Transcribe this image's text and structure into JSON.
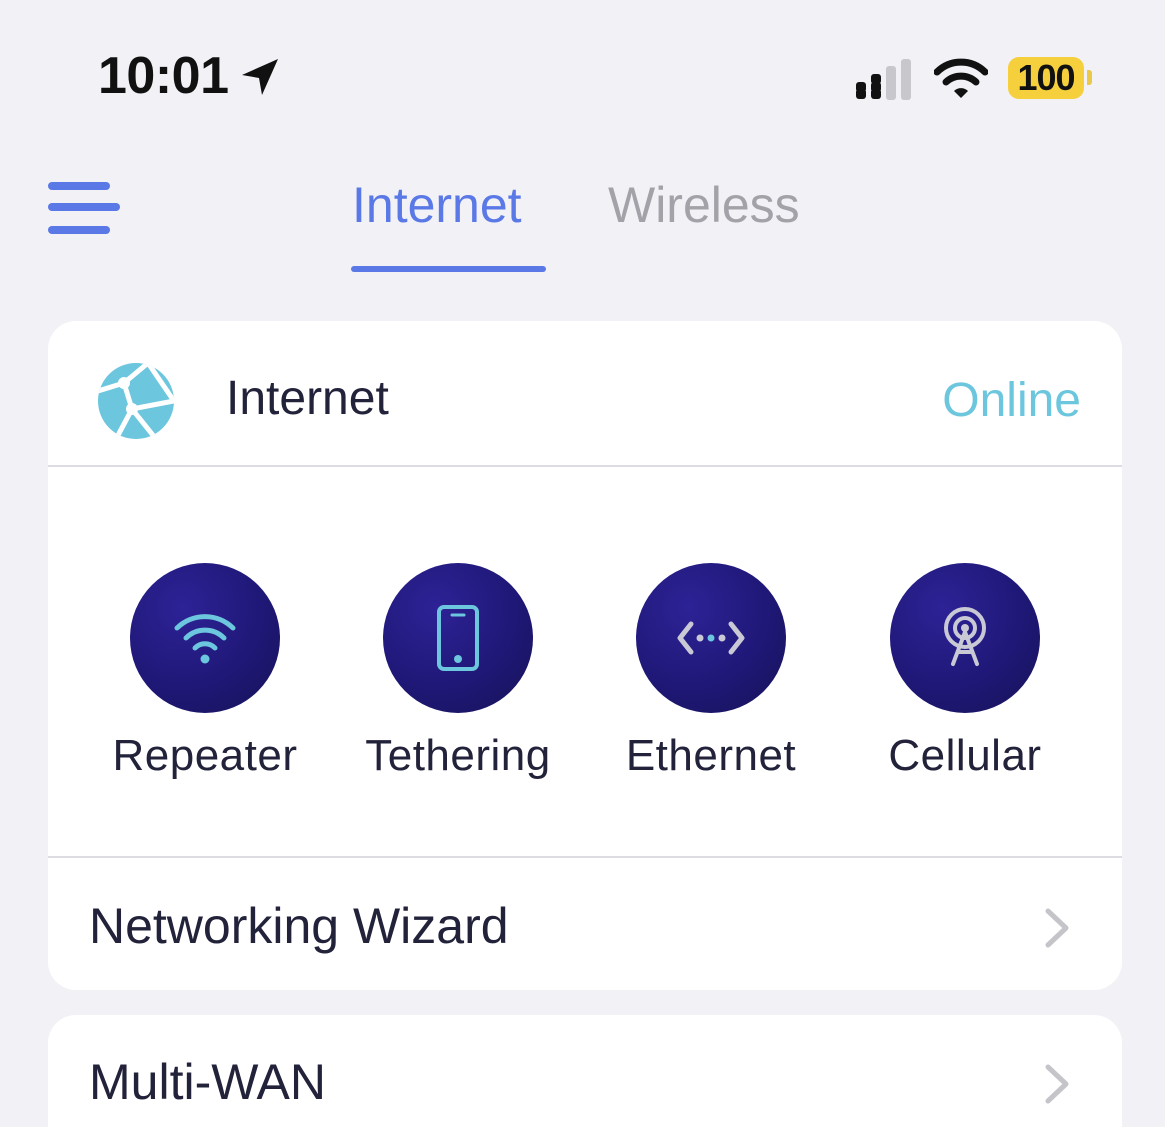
{
  "status_bar": {
    "time": "10:01",
    "location_icon": "location-arrow-icon",
    "signal_icon": "cellular-signal-icon",
    "wifi_icon": "wifi-icon",
    "battery_level": "100",
    "battery_color": "#f6cf3c"
  },
  "header": {
    "menu_icon": "hamburger-menu-icon",
    "tabs": [
      {
        "label": "Internet",
        "active": true
      },
      {
        "label": "Wireless",
        "active": false
      }
    ],
    "accent_color": "#5b79e6"
  },
  "internet_card": {
    "icon": "globe-icon",
    "title": "Internet",
    "status": "Online",
    "status_color": "#6cc6dd",
    "modes": [
      {
        "label": "Repeater",
        "icon": "wifi-icon"
      },
      {
        "label": "Tethering",
        "icon": "phone-icon"
      },
      {
        "label": "Ethernet",
        "icon": "ethernet-icon"
      },
      {
        "label": "Cellular",
        "icon": "cellular-antenna-icon"
      }
    ],
    "mode_circle_color": "#1f1877",
    "wizard_label": "Networking Wizard"
  },
  "multiwan_card": {
    "label": "Multi-WAN"
  }
}
